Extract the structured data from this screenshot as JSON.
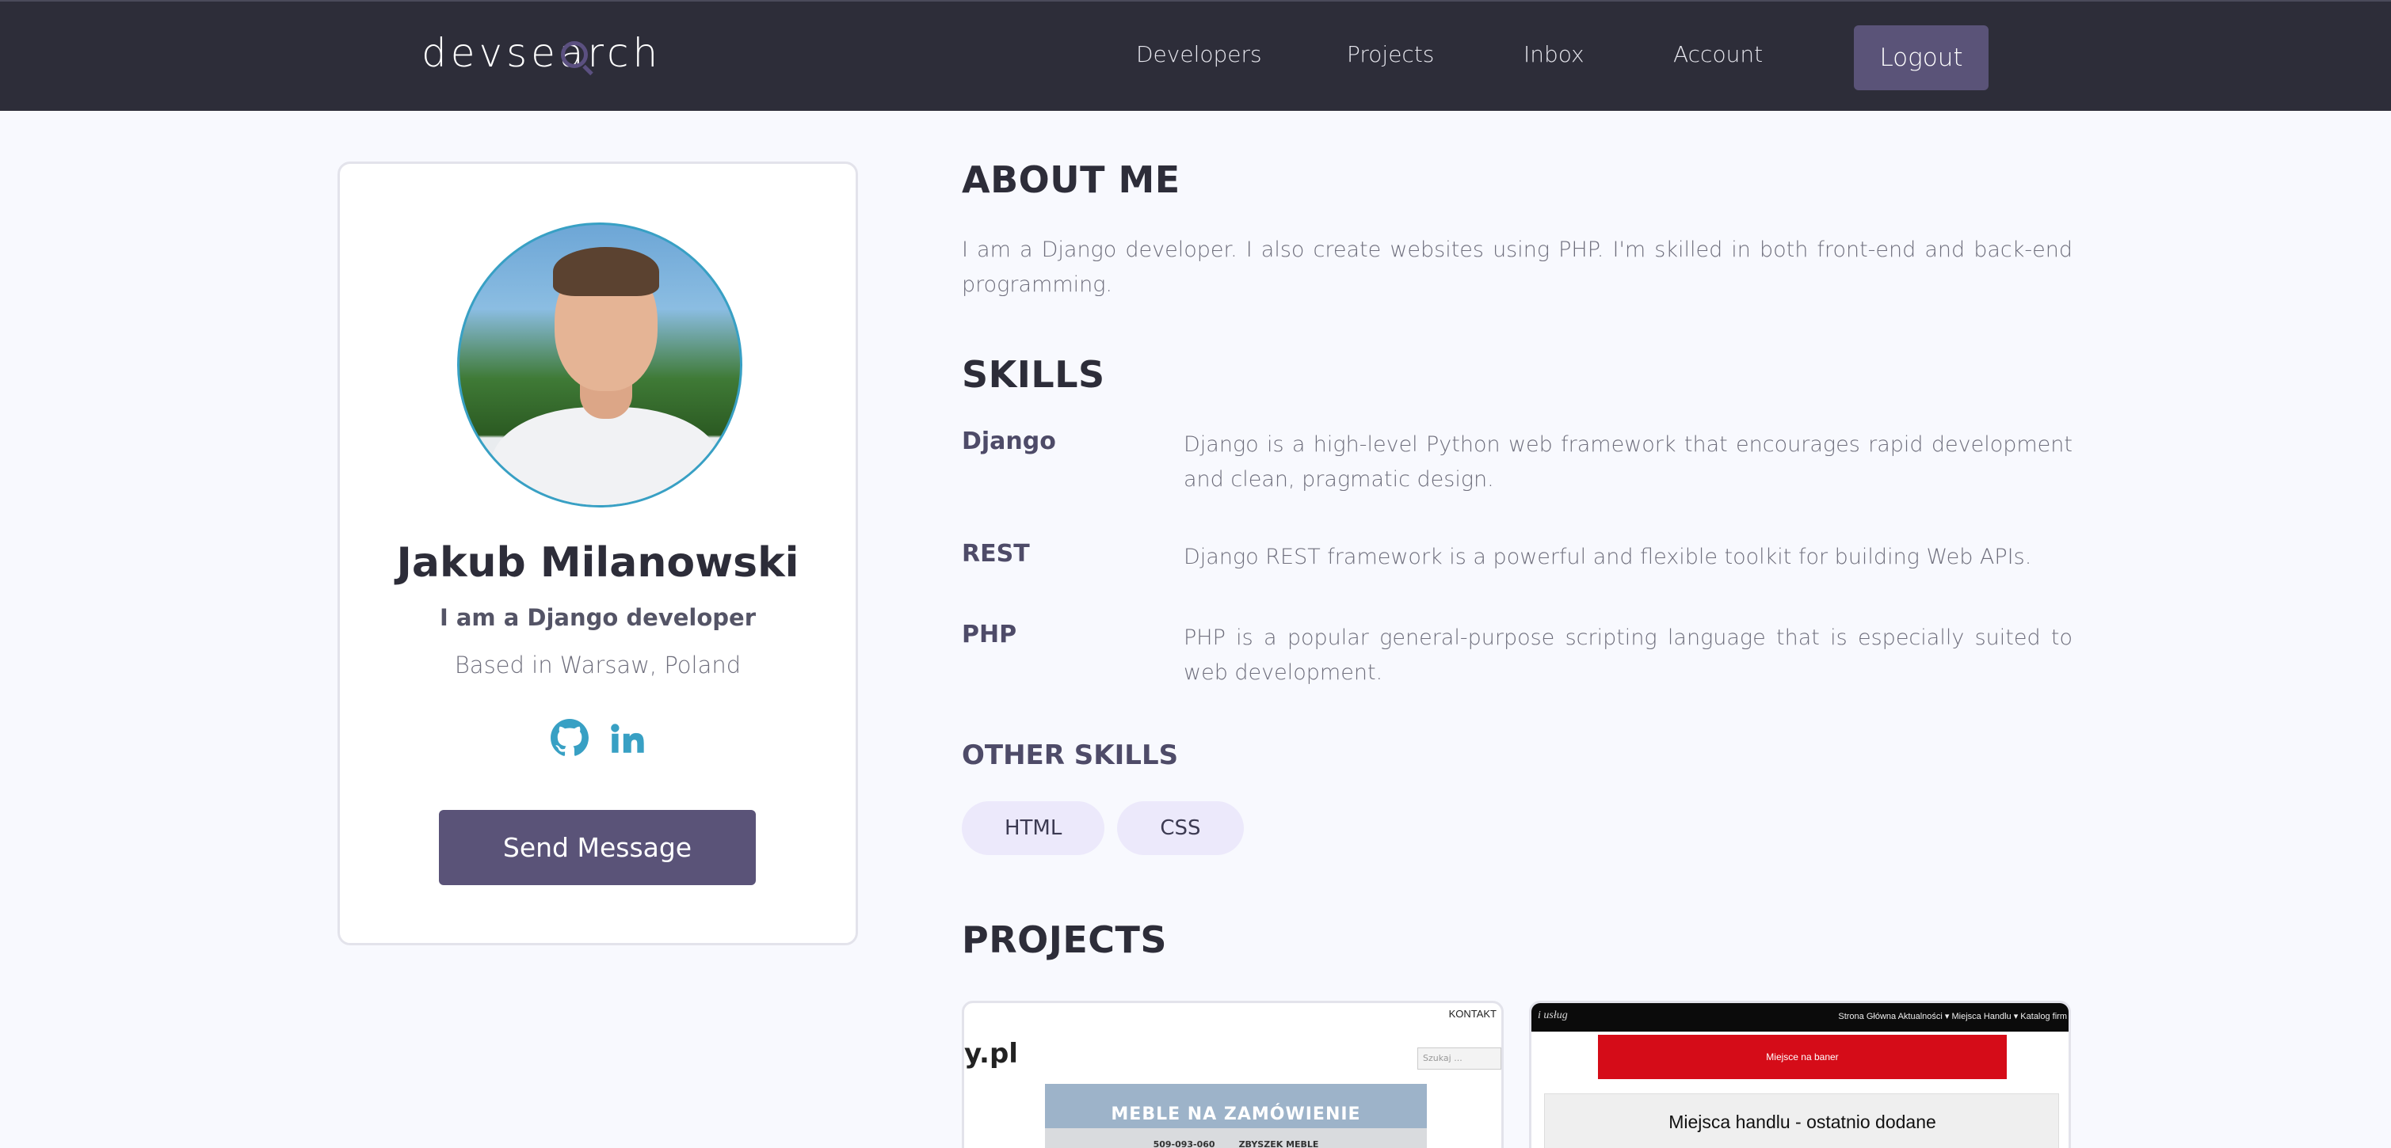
{
  "header": {
    "logo": "devsearch",
    "logo_parts": [
      "devse",
      "a",
      "rch"
    ],
    "nav": [
      "Developers",
      "Projects",
      "Inbox",
      "Account"
    ],
    "logout_label": "Logout"
  },
  "profile": {
    "name": "Jakub Milanowski",
    "headline": "I am a Django developer",
    "location": "Based in Warsaw, Poland",
    "socials": [
      "github-icon",
      "linkedin-icon"
    ],
    "send_message_label": "Send Message"
  },
  "about": {
    "title": "ABOUT ME",
    "text": "I am a Django developer. I also create websites using PHP. I'm skilled in both front-end and back-end programming."
  },
  "skills": {
    "title": "SKILLS",
    "items": [
      {
        "name": "Django",
        "description": "Django is a high-level Python web framework that encourages rapid development and clean, pragmatic design."
      },
      {
        "name": "REST",
        "description": "Django REST framework is a powerful and flexible toolkit for building Web APIs."
      },
      {
        "name": "PHP",
        "description": "PHP is a popular general-purpose scripting language that is especially suited to web development."
      }
    ]
  },
  "other_skills": {
    "title": "OTHER SKILLS",
    "tags": [
      "HTML",
      "CSS"
    ]
  },
  "projects": {
    "title": "PROJECTS",
    "p1": {
      "kontakt": "KONTAKT",
      "brand": "y.pl",
      "search_placeholder": "Szukaj ...",
      "banner_title": "MEBLE NA ZAMÓWIENIE",
      "phone": "509-093-060",
      "owner": "ZBYSZEK MEBLE"
    },
    "p2": {
      "logo": "i usług",
      "menu": "Strona Główna  Aktualności ▾  Miejsca Handlu ▾  Katalog firm",
      "red_banner": "Miejsce na baner",
      "box_title": "Miejsca handlu - ostatnio dodane"
    }
  },
  "colors": {
    "header_bg": "#2d2d39",
    "accent": "#5a5378",
    "link_icons": "#38a0c4",
    "page_bg": "#f8f9fe"
  }
}
